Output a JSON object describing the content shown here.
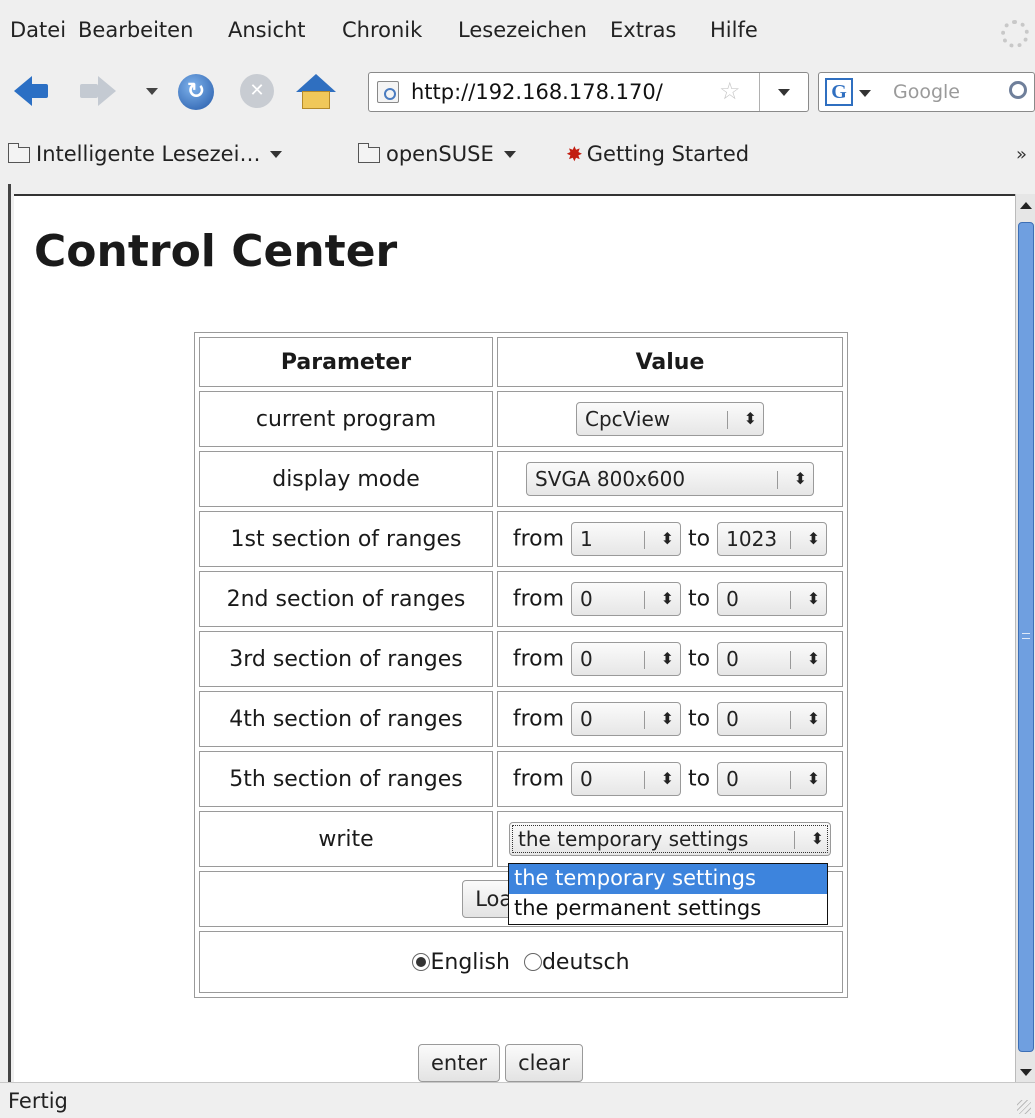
{
  "menu": [
    "Datei",
    "Bearbeiten",
    "Ansicht",
    "Chronik",
    "Lesezeichen",
    "Extras",
    "Hilfe"
  ],
  "toolbar": {
    "url": "http://192.168.178.170/",
    "search_placeholder": "Google",
    "search_engine_glyph": "G"
  },
  "bookmarks": {
    "smart": "Intelligente Lesezei…",
    "opensuse": "openSUSE",
    "getting_started": "Getting Started",
    "more": "»"
  },
  "page": {
    "title": "Control Center",
    "table": {
      "header_parameter": "Parameter",
      "header_value": "Value",
      "current_program": {
        "label": "current program",
        "value": "CpcView"
      },
      "display_mode": {
        "label": "display mode",
        "value": "SVGA 800x600"
      },
      "from_label": "from",
      "to_label": "to",
      "ranges": [
        {
          "label": "1st section of ranges",
          "from": "1",
          "to": "1023"
        },
        {
          "label": "2nd section of ranges",
          "from": "0",
          "to": "0"
        },
        {
          "label": "3rd section of ranges",
          "from": "0",
          "to": "0"
        },
        {
          "label": "4th section of ranges",
          "from": "0",
          "to": "0"
        },
        {
          "label": "5th section of ranges",
          "from": "0",
          "to": "0"
        }
      ],
      "write": {
        "label": "write",
        "value": "the temporary settings",
        "options": [
          "the temporary settings",
          "the permanent settings"
        ]
      },
      "load_button": "Load Set",
      "languages": [
        {
          "label": "English",
          "checked": true
        },
        {
          "label": "deutsch",
          "checked": false
        }
      ]
    },
    "enter_button": "enter",
    "clear_button": "clear"
  },
  "status": "Fertig"
}
